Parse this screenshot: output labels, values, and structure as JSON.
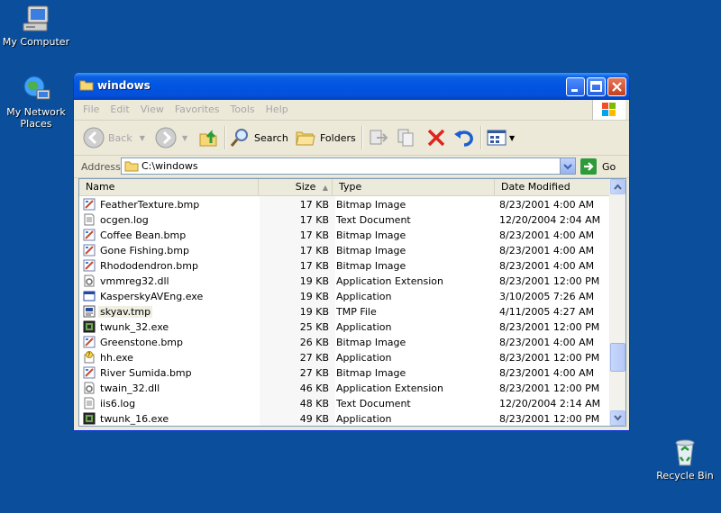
{
  "desktop": {
    "icons": [
      {
        "label": "My Computer",
        "icon": "my-computer-icon"
      },
      {
        "label": "My Network Places",
        "icon": "network-places-icon"
      },
      {
        "label": "Recycle Bin",
        "icon": "recycle-bin-icon"
      }
    ],
    "background_color": "#0b4f9c"
  },
  "window": {
    "title": "windows",
    "menu": [
      "File",
      "Edit",
      "View",
      "Favorites",
      "Tools",
      "Help"
    ],
    "toolbar": {
      "back": "Back",
      "search": "Search",
      "folders": "Folders"
    },
    "address": {
      "label": "Address",
      "value": "C:\\windows",
      "go": "Go"
    },
    "columns": {
      "name": "Name",
      "size": "Size",
      "type": "Type",
      "date": "Date Modified"
    },
    "files": [
      {
        "name": "FeatherTexture.bmp",
        "size": "17 KB",
        "type": "Bitmap Image",
        "date": "8/23/2001 4:00 AM",
        "icon": "bitmap-file-icon"
      },
      {
        "name": "ocgen.log",
        "size": "17 KB",
        "type": "Text Document",
        "date": "12/20/2004 2:04 AM",
        "icon": "text-file-icon"
      },
      {
        "name": "Coffee Bean.bmp",
        "size": "17 KB",
        "type": "Bitmap Image",
        "date": "8/23/2001 4:00 AM",
        "icon": "bitmap-file-icon"
      },
      {
        "name": "Gone Fishing.bmp",
        "size": "17 KB",
        "type": "Bitmap Image",
        "date": "8/23/2001 4:00 AM",
        "icon": "bitmap-file-icon"
      },
      {
        "name": "Rhododendron.bmp",
        "size": "17 KB",
        "type": "Bitmap Image",
        "date": "8/23/2001 4:00 AM",
        "icon": "bitmap-file-icon"
      },
      {
        "name": "vmmreg32.dll",
        "size": "19 KB",
        "type": "Application Extension",
        "date": "8/23/2001 12:00 PM",
        "icon": "dll-file-icon"
      },
      {
        "name": "KasperskyAVEng.exe",
        "size": "19 KB",
        "type": "Application",
        "date": "3/10/2005 7:26 AM",
        "icon": "application-window-icon"
      },
      {
        "name": "skyav.tmp",
        "size": "19 KB",
        "type": "TMP File",
        "date": "4/11/2005 4:27 AM",
        "icon": "tmp-file-icon",
        "selected": true
      },
      {
        "name": "twunk_32.exe",
        "size": "25 KB",
        "type": "Application",
        "date": "8/23/2001 12:00 PM",
        "icon": "twain-exe-icon"
      },
      {
        "name": "Greenstone.bmp",
        "size": "26 KB",
        "type": "Bitmap Image",
        "date": "8/23/2001 4:00 AM",
        "icon": "bitmap-file-icon"
      },
      {
        "name": "hh.exe",
        "size": "27 KB",
        "type": "Application",
        "date": "8/23/2001 12:00 PM",
        "icon": "help-exe-icon"
      },
      {
        "name": "River Sumida.bmp",
        "size": "27 KB",
        "type": "Bitmap Image",
        "date": "8/23/2001 4:00 AM",
        "icon": "bitmap-file-icon"
      },
      {
        "name": "twain_32.dll",
        "size": "46 KB",
        "type": "Application Extension",
        "date": "8/23/2001 12:00 PM",
        "icon": "dll-file-icon"
      },
      {
        "name": "iis6.log",
        "size": "48 KB",
        "type": "Text Document",
        "date": "12/20/2004 2:14 AM",
        "icon": "text-file-icon"
      },
      {
        "name": "twunk_16.exe",
        "size": "49 KB",
        "type": "Application",
        "date": "8/23/2001 12:00 PM",
        "icon": "twain-exe-icon"
      }
    ]
  }
}
